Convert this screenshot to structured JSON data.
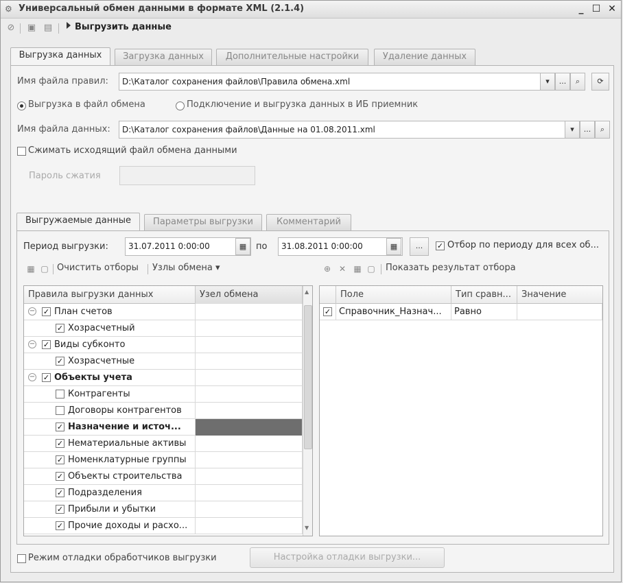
{
  "window": {
    "title": "Универсальный обмен данными в формате XML (2.1.4)",
    "min_btn": "_",
    "max_btn": "☐",
    "close_btn": "✕"
  },
  "toolbar": {
    "run_label": "Выгрузить данные"
  },
  "main_tabs": [
    {
      "label": "Выгрузка данных",
      "active": true
    },
    {
      "label": "Загрузка данных",
      "active": false
    },
    {
      "label": "Дополнительные настройки",
      "active": false
    },
    {
      "label": "Удаление данных",
      "active": false
    }
  ],
  "rules_file": {
    "label": "Имя файла правил:",
    "value": "D:\\Каталог сохранения файлов\\Правила обмена.xml",
    "dropdown_btn": "▾",
    "more_btn": "...",
    "search_btn": "🔍",
    "reload_btn": "⟳"
  },
  "export_mode": {
    "option_file": "Выгрузка в файл обмена",
    "option_db": "Подключение и выгрузка данных в ИБ приемник"
  },
  "data_file": {
    "label": "Имя файла данных:",
    "value": "D:\\Каталог сохранения файлов\\Данные на 01.08.2011.xml",
    "dropdown_btn": "▾",
    "more_btn": "...",
    "search_btn": "🔍"
  },
  "compress": {
    "label": "Сжимать исходящий файл обмена данными"
  },
  "password": {
    "label": "Пароль сжатия",
    "value": ""
  },
  "inner_tabs": [
    {
      "label": "Выгружаемые данные",
      "active": true
    },
    {
      "label": "Параметры выгрузки",
      "active": false
    },
    {
      "label": "Комментарий",
      "active": false
    }
  ],
  "period": {
    "label": "Период выгрузки:",
    "from": "31.07.2011  0:00:00",
    "to_label": "по",
    "to": "31.08.2011  0:00:00",
    "cal_btn": "▦",
    "more_btn": "...",
    "filter_label": "Отбор по периоду для всех об..."
  },
  "left_toolbar": {
    "clear_label": "Очистить отборы",
    "nodes_label": "Узлы обмена",
    "nodes_arrow": "▾"
  },
  "right_toolbar": {
    "show_label": "Показать результат отбора"
  },
  "rules_grid": {
    "headers": [
      "Правила выгрузки данных",
      "Узел обмена"
    ],
    "rows": [
      {
        "label": "План счетов",
        "level": 0,
        "checked": true,
        "group": true,
        "bold": false,
        "selected": false
      },
      {
        "label": "Хозрасчетный",
        "level": 1,
        "checked": true,
        "group": false,
        "bold": false,
        "selected": false
      },
      {
        "label": "Виды субконто",
        "level": 0,
        "checked": true,
        "group": true,
        "bold": false,
        "selected": false
      },
      {
        "label": "Хозрасчетные",
        "level": 1,
        "checked": true,
        "group": false,
        "bold": false,
        "selected": false
      },
      {
        "label": "Объекты учета",
        "level": 0,
        "checked": true,
        "group": true,
        "bold": true,
        "selected": false
      },
      {
        "label": "Контрагенты",
        "level": 1,
        "checked": false,
        "group": false,
        "bold": false,
        "selected": false
      },
      {
        "label": "Договоры контрагентов",
        "level": 1,
        "checked": false,
        "group": false,
        "bold": false,
        "selected": false
      },
      {
        "label": "Назначение и источ...",
        "level": 1,
        "checked": true,
        "group": false,
        "bold": true,
        "selected": true
      },
      {
        "label": "Нематериальные активы",
        "level": 1,
        "checked": true,
        "group": false,
        "bold": false,
        "selected": false
      },
      {
        "label": "Номенклатурные группы",
        "level": 1,
        "checked": true,
        "group": false,
        "bold": false,
        "selected": false
      },
      {
        "label": "Объекты строительства",
        "level": 1,
        "checked": true,
        "group": false,
        "bold": false,
        "selected": false
      },
      {
        "label": "Подразделения",
        "level": 1,
        "checked": true,
        "group": false,
        "bold": false,
        "selected": false
      },
      {
        "label": "Прибыли и убытки",
        "level": 1,
        "checked": true,
        "group": false,
        "bold": false,
        "selected": false
      },
      {
        "label": "Прочие доходы и расхо...",
        "level": 1,
        "checked": true,
        "group": false,
        "bold": false,
        "selected": false
      }
    ]
  },
  "filter_grid": {
    "headers": [
      "",
      "Поле",
      "Тип сравн...",
      "Значение"
    ],
    "rows": [
      {
        "checked": true,
        "field": "Справочник_Назнач...",
        "compare": "Равно",
        "value": ""
      }
    ]
  },
  "debug": {
    "label": "Режим отладки обработчиков выгрузки",
    "button": "Настройка отладки выгрузки..."
  }
}
